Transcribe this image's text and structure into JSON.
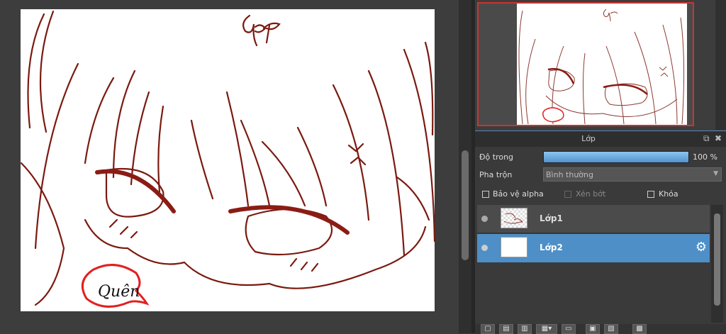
{
  "layer_panel": {
    "title": "Lớp",
    "opacity_label": "Độ trong",
    "opacity_value": "100 %",
    "opacity_percent": 100,
    "blend_label": "Pha trộn",
    "blend_value": "Bình thường",
    "protect_alpha_label": "Bảo vệ alpha",
    "clipping_label": "Xén bớt",
    "lock_label": "Khóa",
    "layers": [
      {
        "name": "Lớp1",
        "selected": false
      },
      {
        "name": "Lớp2",
        "selected": true
      }
    ]
  },
  "canvas_texts": {
    "top_signature": "Gg",
    "bubble_text": "Quên"
  },
  "colors": {
    "accent": "#4e8fc7",
    "line_art": "#7a1a10",
    "nav_frame": "#cc3333",
    "panel_bg": "#3a3a3a"
  },
  "icons": {
    "expand": "popout-icon",
    "close": "close-icon",
    "settings": "gear-icon",
    "dropdown": "chevron-down-icon"
  }
}
